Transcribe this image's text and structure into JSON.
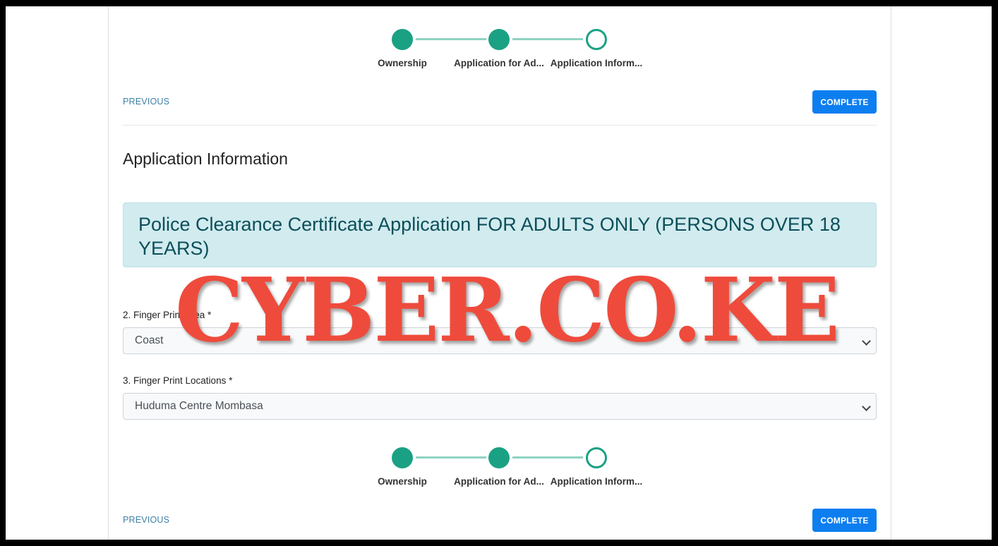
{
  "stepper": {
    "steps": [
      {
        "label": "Ownership",
        "state": "completed"
      },
      {
        "label": "Application for Ad...",
        "state": "completed"
      },
      {
        "label": "Application Inform...",
        "state": "current"
      }
    ]
  },
  "navigation": {
    "previous_label": "PREVIOUS",
    "complete_label": "COMPLETE"
  },
  "section": {
    "title": "Application Information",
    "alert_text": "Police Clearance Certificate Application FOR ADULTS ONLY (PERSONS OVER 18 YEARS)"
  },
  "form": {
    "fields": [
      {
        "label": "2. Finger Print Area *",
        "value": "Coast"
      },
      {
        "label": "3. Finger Print Locations *",
        "value": "Huduma Centre Mombasa"
      }
    ]
  },
  "watermark": {
    "text": "CYBER.CO.KE"
  },
  "colors": {
    "step_active": "#1aa184",
    "step_line": "#8fd3c1",
    "primary_button": "#0d7ef0",
    "alert_bg": "#d1ebef",
    "alert_text": "#0c4f5a",
    "watermark": "#ee4b3c"
  }
}
